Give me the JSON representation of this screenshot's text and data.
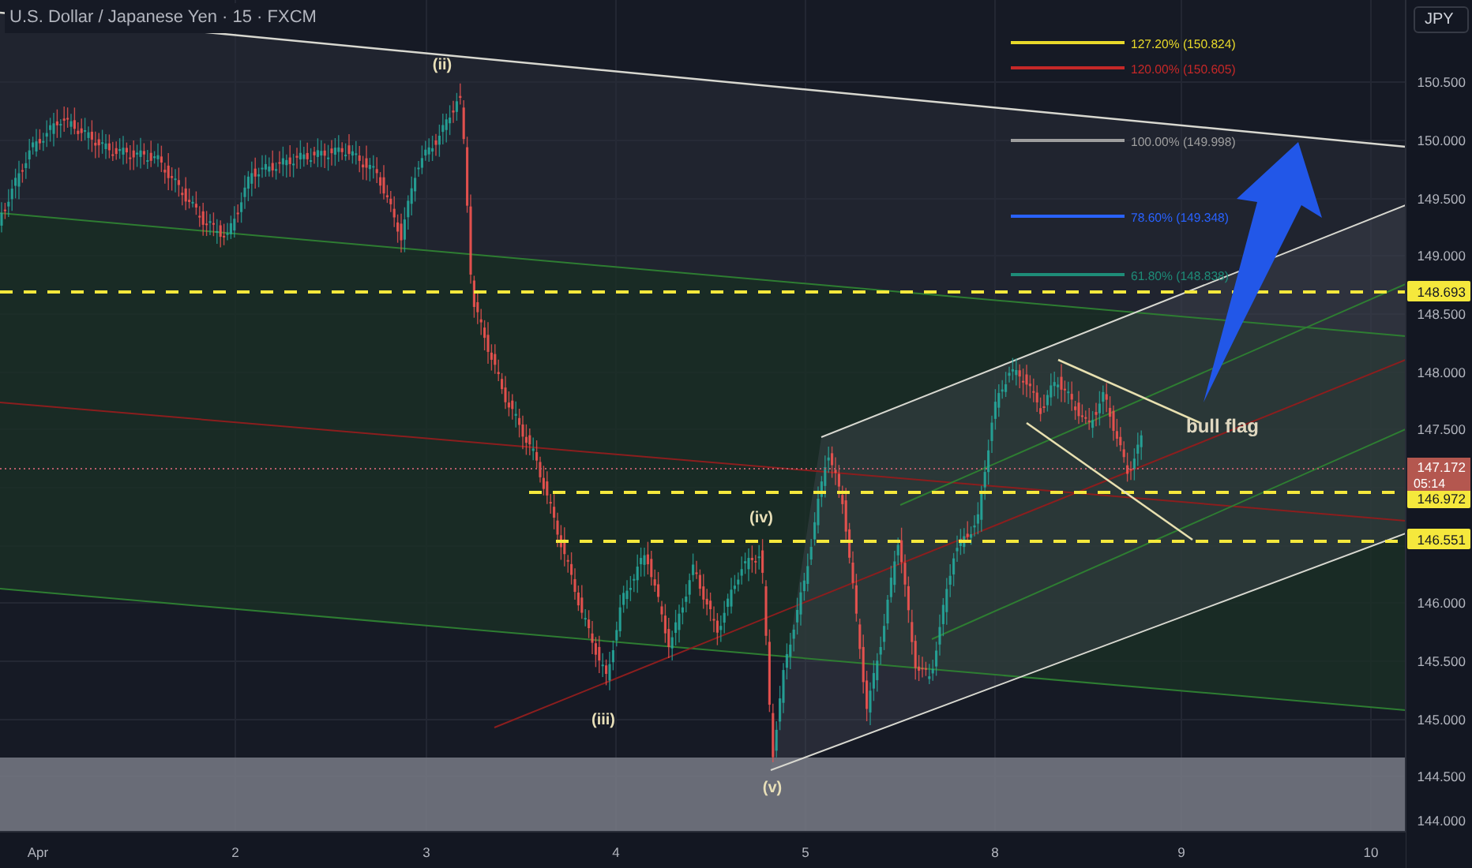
{
  "header": {
    "title": "U.S. Dollar / Japanese Yen · 15 · FXCM"
  },
  "currency_button": "JPY",
  "price_axis": [
    "150.500",
    "150.000",
    "149.500",
    "149.000",
    "148.500",
    "148.000",
    "147.500",
    "146.000",
    "145.500",
    "145.000",
    "144.500",
    "144.000"
  ],
  "price_tags": [
    "148.693",
    "146.972",
    "146.551"
  ],
  "current_price": {
    "price": "147.172",
    "countdown": "05:14"
  },
  "time_axis": [
    "Apr",
    "2",
    "3",
    "4",
    "5",
    "8",
    "9",
    "10"
  ],
  "fib_levels": [
    {
      "label": "127.20% (150.824)",
      "color": "#e8d92a"
    },
    {
      "label": "120.00% (150.605)",
      "color": "#c62828"
    },
    {
      "label": "100.00% (149.998)",
      "color": "#9e9e9e"
    },
    {
      "label": "78.60% (149.348)",
      "color": "#2962ff"
    },
    {
      "label": "61.80% (148.838)",
      "color": "#1e8c78"
    }
  ],
  "wave_labels": [
    "(ii)",
    "(iii)",
    "(iv)",
    "(v)"
  ],
  "annotation": "bull flag"
}
